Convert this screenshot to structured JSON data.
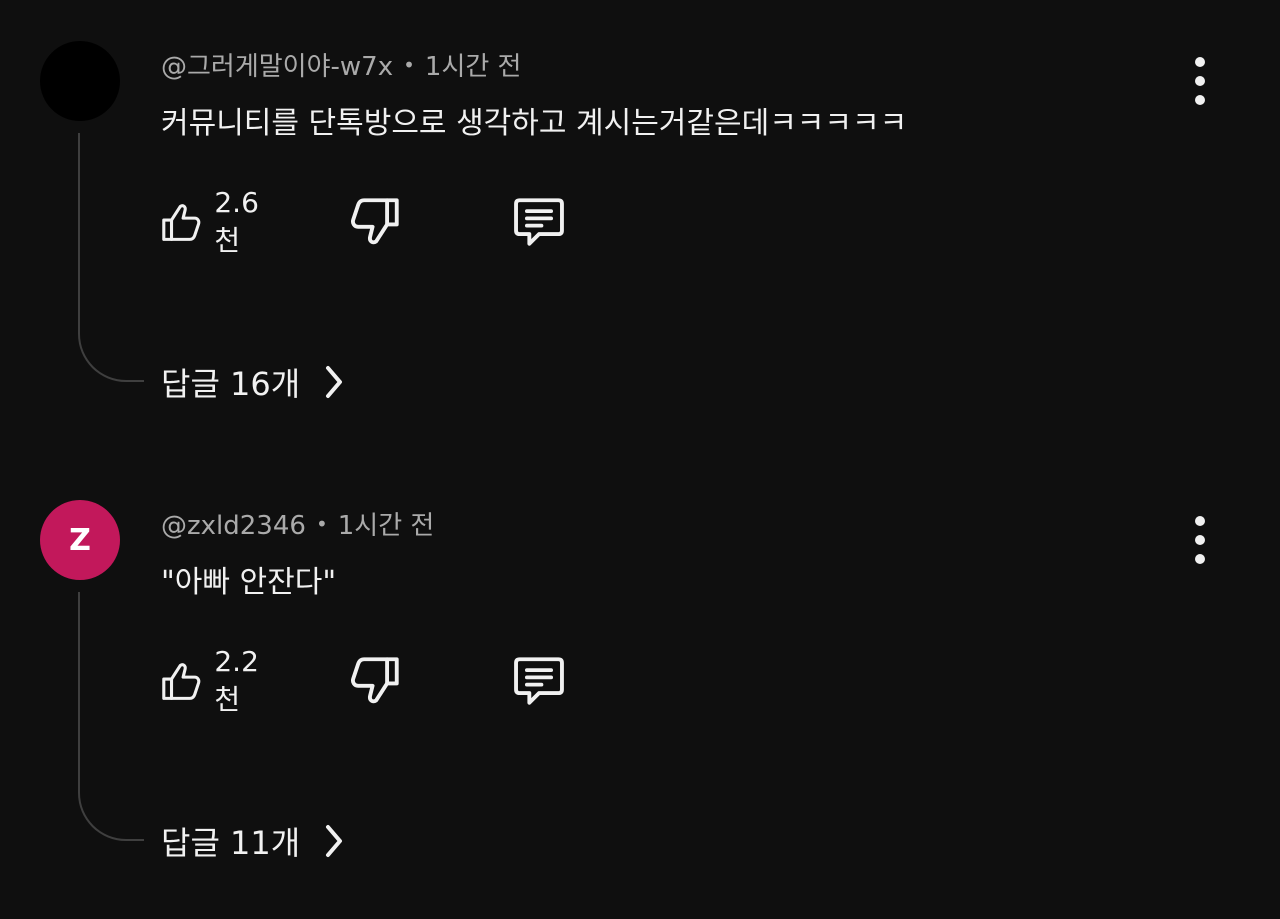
{
  "comments": [
    {
      "avatar_letter": "",
      "avatar_color": "#000000",
      "author": "@그러게말이야-w7x",
      "separator": "•",
      "time": "1시간 전",
      "text": "커뮤니티를 단톡방으로 생각하고 계시는거같은데ㅋㅋㅋㅋㅋ",
      "likes": "2.6천",
      "replies_label": "답글 16개"
    },
    {
      "avatar_letter": "Z",
      "avatar_color": "#c2185b",
      "author": "@zxld2346",
      "separator": "•",
      "time": "1시간 전",
      "text": "\"아빠 안잔다\"",
      "likes": "2.2천",
      "replies_label": "답글 11개"
    }
  ],
  "icons": {
    "like": "thumbs-up-icon",
    "dislike": "thumbs-down-icon",
    "reply": "comment-icon",
    "more": "more-vert-icon",
    "chevron": "chevron-right-icon"
  },
  "colors": {
    "background": "#0f0f0f",
    "text": "#f1f1f1",
    "meta": "#aaaaaa",
    "thread_line": "#3f3f3f"
  }
}
